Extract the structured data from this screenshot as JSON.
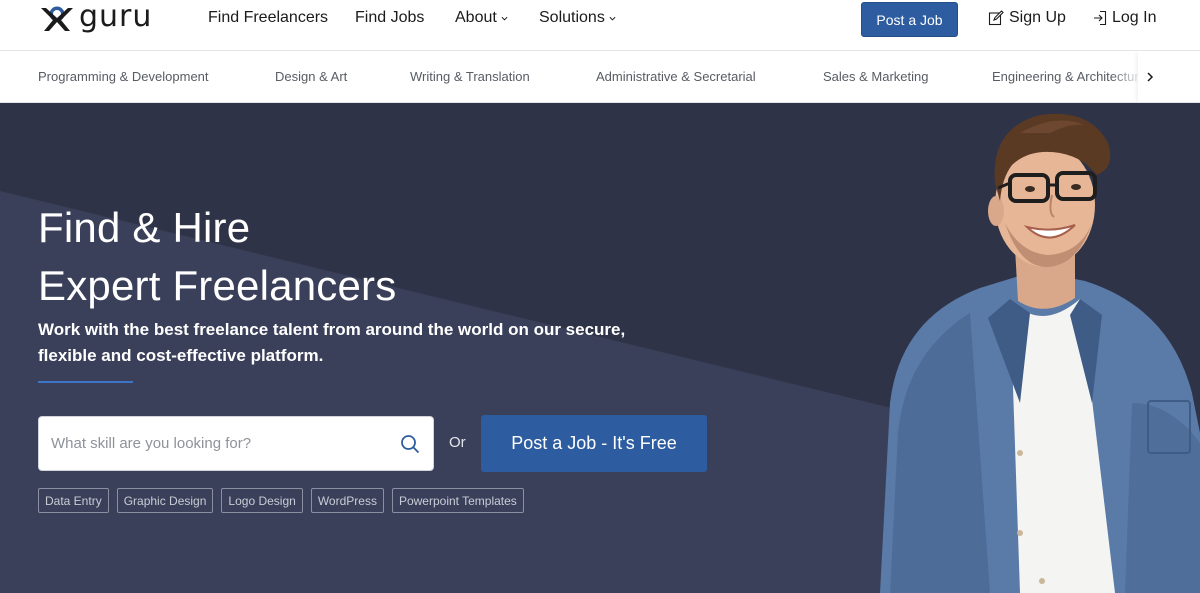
{
  "brand": {
    "name": "guru"
  },
  "nav": {
    "links": [
      {
        "label": "Find Freelancers"
      },
      {
        "label": "Find Jobs"
      },
      {
        "label": "About"
      },
      {
        "label": "Solutions"
      }
    ],
    "post_job_label": "Post a Job",
    "sign_up_label": "Sign Up",
    "log_in_label": "Log In"
  },
  "categories": [
    "Programming & Development",
    "Design & Art",
    "Writing & Translation",
    "Administrative & Secretarial",
    "Sales & Marketing",
    "Engineering & Architecture"
  ],
  "hero": {
    "title_line1": "Find & Hire",
    "title_line2": "Expert Freelancers",
    "subtitle": "Work with the best freelance talent from around the world on our secure, flexible and cost-effective platform.",
    "search_placeholder": "What skill are you looking for?",
    "or_label": "Or",
    "cta_label": "Post a Job - It's Free",
    "tags": [
      "Data Entry",
      "Graphic Design",
      "Logo Design",
      "WordPress",
      "Powerpoint Templates"
    ]
  },
  "colors": {
    "primary": "#2d5da0",
    "hero_bg": "#2f3347",
    "hero_bg_light": "#3b405a",
    "accent_rule": "#3e74c7"
  },
  "icons": {
    "search": "search-icon",
    "sign_up": "edit-icon",
    "log_in": "login-icon",
    "dropdown": "chevron-down-icon",
    "scroll": "chevron-right-icon"
  }
}
